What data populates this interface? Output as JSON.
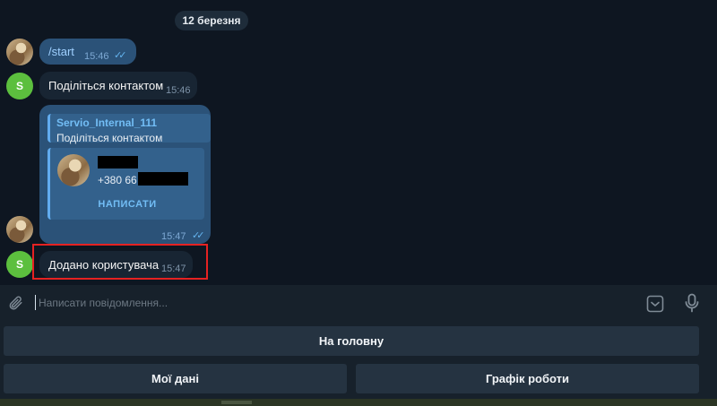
{
  "chat": {
    "date_label": "12 березня",
    "messages": [
      {
        "text": "/start",
        "time": "15:46",
        "checks": "✓✓"
      },
      {
        "text": "Поділіться контактом",
        "time": "15:46",
        "avatar_letter": "S"
      },
      {
        "reply_name": "Servio_Internal_111",
        "reply_text": "Поділіться контактом",
        "contact_phone_prefix": "+380 66",
        "contact_button": "НАПИСАТИ",
        "time": "15:47",
        "checks": "✓✓"
      },
      {
        "text": "Додано користувача",
        "time": "15:47",
        "avatar_letter": "S"
      }
    ]
  },
  "composer": {
    "placeholder": "Написати повідомлення...",
    "icons": [
      "paperclip-icon",
      "bot-keyboard-icon",
      "microphone-icon"
    ]
  },
  "keyboard": {
    "home": "На головну",
    "my_data": "Мої дані",
    "schedule": "Графік роботи"
  },
  "colors": {
    "background": "#0e1621",
    "outgoing_bubble": "#2b5278",
    "incoming_bubble": "#182533",
    "accent": "#72bdf5",
    "highlight": "#e52222"
  }
}
